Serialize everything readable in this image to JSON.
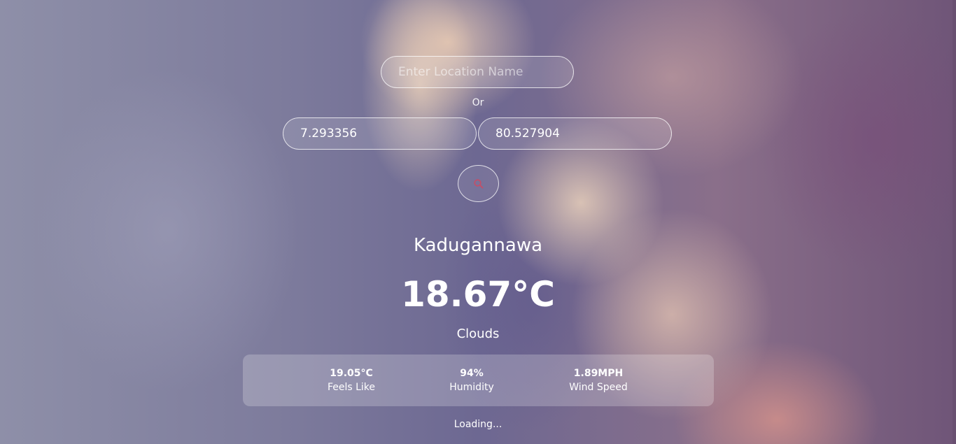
{
  "search": {
    "location_placeholder": "Enter Location Name",
    "location_value": "",
    "or_label": "Or",
    "latitude_value": "7.293356",
    "longitude_value": "80.527904",
    "search_icon": "search-icon",
    "search_icon_color": "#c0506a"
  },
  "weather": {
    "city": "Kadugannawa",
    "temperature": "18.67°C",
    "condition": "Clouds"
  },
  "details": {
    "feels_like": {
      "value": "19.05°C",
      "label": "Feels Like"
    },
    "humidity": {
      "value": "94%",
      "label": "Humidity"
    },
    "wind_speed": {
      "value": "1.89MPH",
      "label": "Wind Speed"
    }
  },
  "status": {
    "loading_text": "Loading..."
  }
}
